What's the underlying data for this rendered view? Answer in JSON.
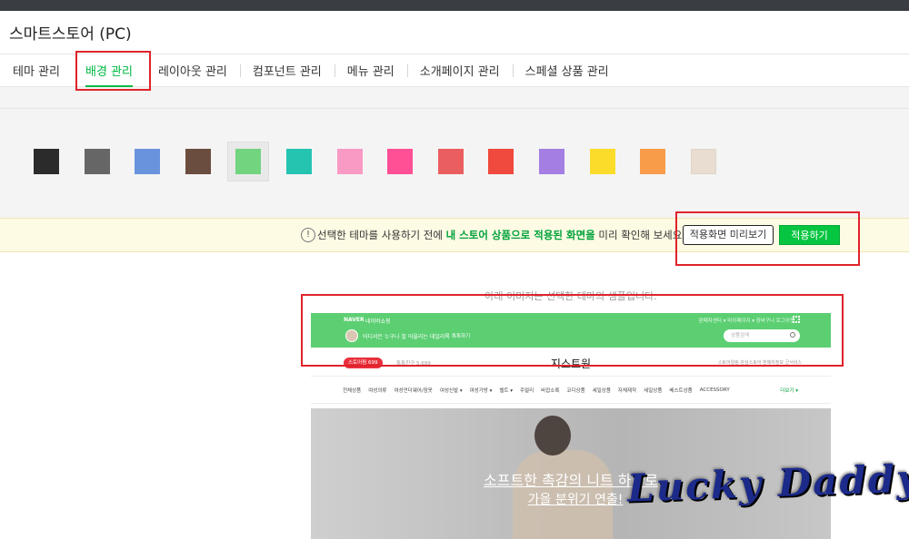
{
  "window": {
    "title": "스마트스토어 (PC)"
  },
  "tabs": [
    {
      "label": "테마 관리"
    },
    {
      "label": "배경 관리"
    },
    {
      "label": "레이아웃 관리"
    },
    {
      "label": "컴포넌트 관리"
    },
    {
      "label": "메뉴 관리"
    },
    {
      "label": "소개페이지 관리"
    },
    {
      "label": "스페셜 상품 관리"
    }
  ],
  "active_tab": "배경 관리",
  "swatches": [
    {
      "color": "#2b2b2b"
    },
    {
      "color": "#666666"
    },
    {
      "color": "#6a93dd"
    },
    {
      "color": "#6b4d3f"
    },
    {
      "color": "#72d47f",
      "selected": true
    },
    {
      "color": "#24c4b0"
    },
    {
      "color": "#f99ac4"
    },
    {
      "color": "#ff4f95"
    },
    {
      "color": "#eb5e60"
    },
    {
      "color": "#f0493d"
    },
    {
      "color": "#a47ee2"
    },
    {
      "color": "#fcdc2a"
    },
    {
      "color": "#f89c4a"
    },
    {
      "color": "#e8ddd0"
    }
  ],
  "notice": {
    "icon": "exclamation-circle-icon",
    "text_before": "선택한 테마를 사용하기 전에 ",
    "text_highlight": "내 스토어 상품으로 적용된 화면을",
    "text_after": " 미리 확인해 보세요.",
    "preview_button": "적용화면 미리보기",
    "apply_button": "적용하기"
  },
  "sample": {
    "caption": "아래 이미지는 선택한 테마의 샘플입니다.",
    "header_naver": "NAVER",
    "header_store": "네이버쇼핑",
    "header_menu": "판매자센터 ▾   마이페이지 ▾   장바구니   로그아웃",
    "slogan": "어디서든 누구나 잘 어울리는 데일리룩",
    "fav": "톡톡하기",
    "search_placeholder": "상품검색",
    "talk_badge": "스토어찜 699",
    "friend": "톡톡친구 5,699",
    "store_name": "지스트원",
    "side_info": "스토어알림  관심스토어  판매자정보  굿서비스",
    "categories": [
      "전체상품",
      "여성의류",
      "여성언더웨어/잠옷",
      "여성신발 ▾",
      "여성가방 ▾",
      "벨트 ▾",
      "주얼리",
      "바잡소록",
      "코디상품",
      "세일상품",
      "자체제작",
      "세일상품",
      "베스트상품",
      "ACCESSORY"
    ],
    "more": "더보기 ▾",
    "hero_line1": "소프트한 촉감의 니트 하나로",
    "hero_line2": "가을 분위기 연출!"
  },
  "watermark": "Lucky Daddy",
  "colors": {
    "accent": "#00b843",
    "highlight_box": "#e0232a",
    "apply_button": "#06c540"
  }
}
